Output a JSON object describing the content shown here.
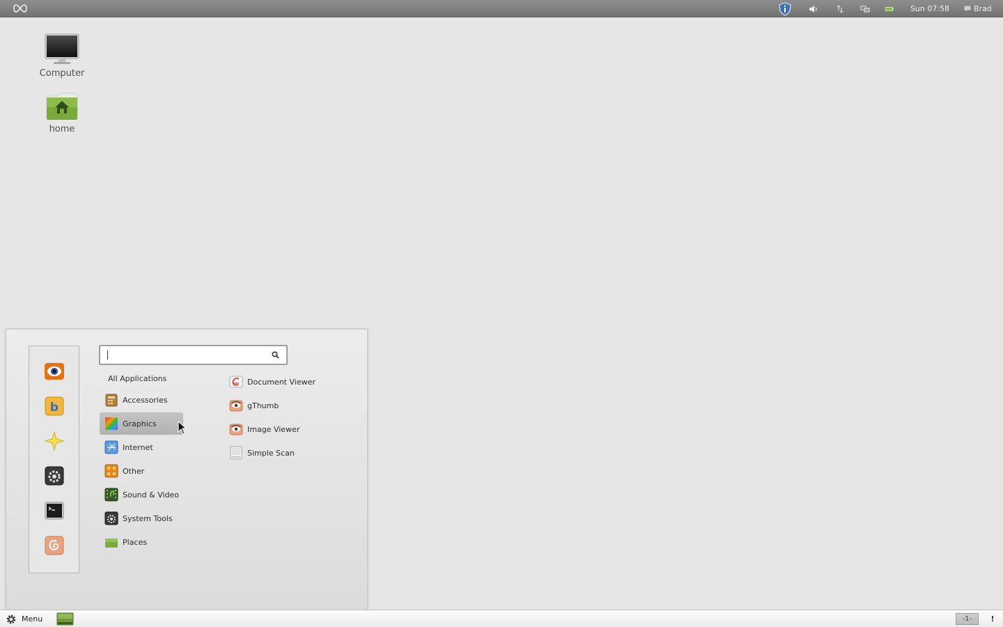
{
  "top_panel": {
    "clock": "Sun 07:58",
    "user": "Brad",
    "icons": [
      "cinnamon-logo-icon",
      "update-shield-icon",
      "volume-icon",
      "network-icon",
      "display-icon",
      "battery-icon",
      "user-icon"
    ]
  },
  "desktop": {
    "icons": [
      {
        "label": "Computer",
        "icon": "computer-icon"
      },
      {
        "label": "home",
        "icon": "home-folder-icon"
      }
    ]
  },
  "menu": {
    "search": {
      "value": "",
      "placeholder": ""
    },
    "favorites": [
      "gnome-eye-icon",
      "blueman-icon",
      "star-icon",
      "settings-icon",
      "terminal-icon",
      "debian-swirl-icon"
    ],
    "all_apps_label": "All Applications",
    "categories": [
      {
        "label": "Accessories",
        "icon": "accessories-icon"
      },
      {
        "label": "Graphics",
        "icon": "graphics-icon",
        "selected": true
      },
      {
        "label": "Internet",
        "icon": "internet-icon"
      },
      {
        "label": "Other",
        "icon": "other-icon"
      },
      {
        "label": "Sound & Video",
        "icon": "sound-video-icon"
      },
      {
        "label": "System Tools",
        "icon": "system-tools-icon"
      },
      {
        "label": "Places",
        "icon": "places-folder-icon"
      }
    ],
    "apps": [
      {
        "label": "Document Viewer",
        "icon": "document-viewer-icon"
      },
      {
        "label": "gThumb",
        "icon": "gthumb-icon"
      },
      {
        "label": "Image Viewer",
        "icon": "image-viewer-icon"
      },
      {
        "label": "Simple Scan",
        "icon": "simple-scan-icon"
      }
    ]
  },
  "bottom_panel": {
    "menu_label": "Menu",
    "workspace": "-1-",
    "notification": "!"
  },
  "colors": {
    "desktop_bg": "#e6e6e6",
    "top_panel": "#7e7e7e",
    "selection": "#b8b8b8"
  }
}
